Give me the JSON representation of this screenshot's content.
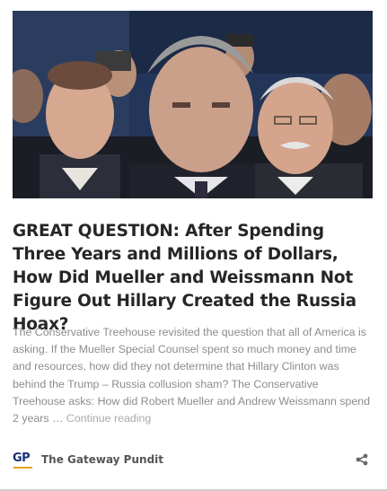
{
  "article": {
    "image_alt": "Robert Mueller at hearing",
    "headline": "GREAT QUESTION: After Spending Three Years and Millions of Dollars, How Did Mueller and Weissmann Not Figure Out Hillary Created the Russia Hoax?",
    "excerpt": "The Conservative Treehouse revisited the question that all of America is asking.  If the Mueller Special Counsel spent so much money and time and resources, how did they not determine that Hillary Clinton was behind the Trump – Russia collusion sham? The Conservative Treehouse asks: How did Robert Mueller and Andrew Weissmann spend 2 years …",
    "read_more": "Continue reading"
  },
  "source": {
    "logo_text": "GP",
    "name": "The Gateway Pundit"
  },
  "icons": {
    "share": "share-icon"
  },
  "colors": {
    "headline": "#262626",
    "excerpt": "#8c8c8c",
    "logo": "#1a2f73",
    "logo_accent": "#e0a21c"
  }
}
